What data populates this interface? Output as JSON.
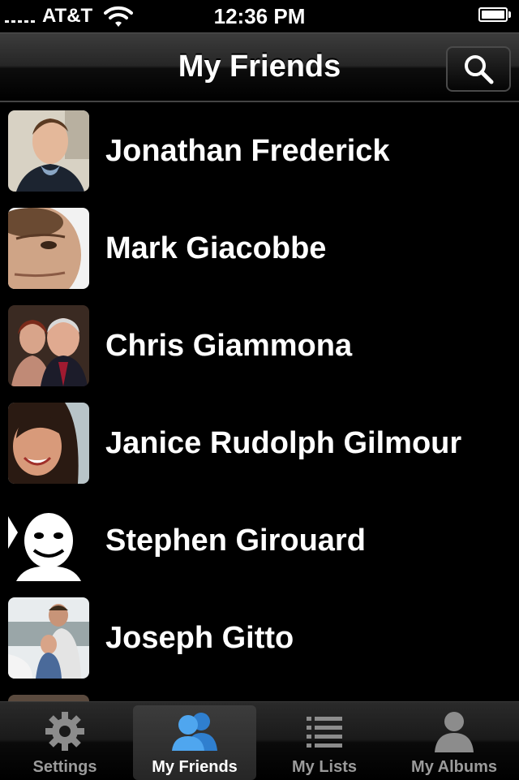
{
  "status_bar": {
    "carrier": "AT&T",
    "time": "12:36 PM"
  },
  "nav": {
    "title": "My Friends",
    "search_icon": "search-icon"
  },
  "friends": [
    {
      "name": "Jonathan Frederick"
    },
    {
      "name": "Mark Giacobbe"
    },
    {
      "name": "Chris Giammona"
    },
    {
      "name": "Janice Rudolph Gilmour"
    },
    {
      "name": "Stephen Girouard"
    },
    {
      "name": "Joseph Gitto"
    }
  ],
  "tab_bar": {
    "tabs": [
      {
        "label": "Settings",
        "icon": "gear-icon",
        "selected": false
      },
      {
        "label": "My Friends",
        "icon": "friends-icon",
        "selected": true
      },
      {
        "label": "My Lists",
        "icon": "list-icon",
        "selected": false
      },
      {
        "label": "My Albums",
        "icon": "person-icon",
        "selected": false
      }
    ]
  },
  "colors": {
    "accent_blue": "#3a8fd9",
    "tab_inactive": "#9b9b9b"
  }
}
